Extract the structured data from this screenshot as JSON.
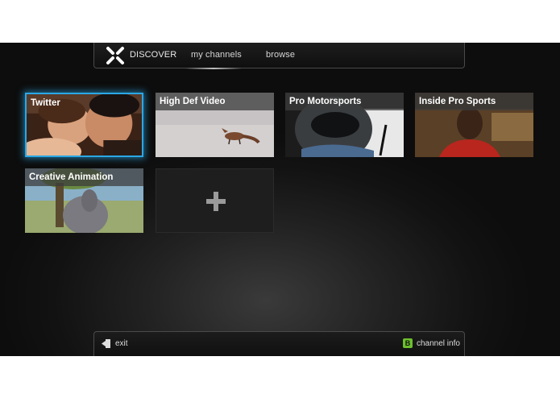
{
  "nav": {
    "discover": "DISCOVER",
    "my_channels": "my channels",
    "browse": "browse"
  },
  "channels": [
    {
      "title": "Twitter",
      "selected": true
    },
    {
      "title": "High Def Video",
      "selected": false
    },
    {
      "title": "Pro Motorsports",
      "selected": false
    },
    {
      "title": "Inside Pro Sports",
      "selected": false
    },
    {
      "title": "Creative Animation",
      "selected": false
    }
  ],
  "add_tile": {
    "icon": "plus-icon"
  },
  "footer": {
    "exit_label": "exit",
    "channel_info_key": "B",
    "channel_info_label": "channel info"
  },
  "colors": {
    "selection": "#2aa8e6",
    "badge": "#6cbf2c"
  }
}
